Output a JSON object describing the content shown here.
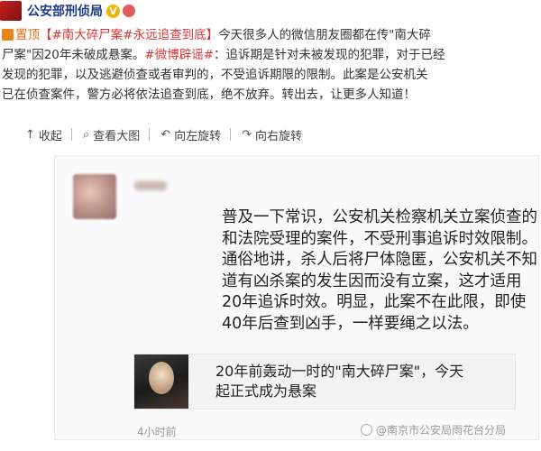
{
  "header": {
    "author": "公安部刑侦局",
    "verified_badge": "V",
    "icons": [
      "verified-icon",
      "member-badge-icon"
    ]
  },
  "post": {
    "pin_label": "置顶",
    "topic1": "【#南大碎尸案#永远追查到底】",
    "line1_rest": "今天很多人的微信朋友圈都在传\"南大碎",
    "line2_a": "尸案\"因20年未破成悬案。",
    "topic2": "#微博辟谣#",
    "line2_b": "：追诉期是针对未被发现的犯罪，对于已经",
    "line3": "发现的犯罪，以及逃避侦查或者审判的，不受追诉期限的限制。此案是公安机关",
    "line4": "已在侦查案件，警方必将依法追查到底，绝不放弃。转出去，让更多人知道！"
  },
  "toolbar": {
    "collect": "收起",
    "view_large": "查看大图",
    "rotate_left": "向左旋转",
    "rotate_right": "向右旋转"
  },
  "repost": {
    "lines": [
      "普及一下常识，公安机关检察机关立案侦查的",
      "和法院受理的案件，不受刑事追诉时效限制。",
      "通俗地讲，杀人后将尸体隐匿，公安机关不知",
      "道有凶杀案的发生因而没有立案，这才适用",
      "20年追诉时效。明显，此案不在此限，即使",
      "40年后查到凶手，一样要绳之以法。"
    ],
    "link_title_line1": "20年前轰动一时的\"南大碎尸案\"，今天",
    "link_title_line2": "起正式成为悬案",
    "timestamp": "4小时前",
    "watermark": "@南京市公安局雨花台分局"
  }
}
